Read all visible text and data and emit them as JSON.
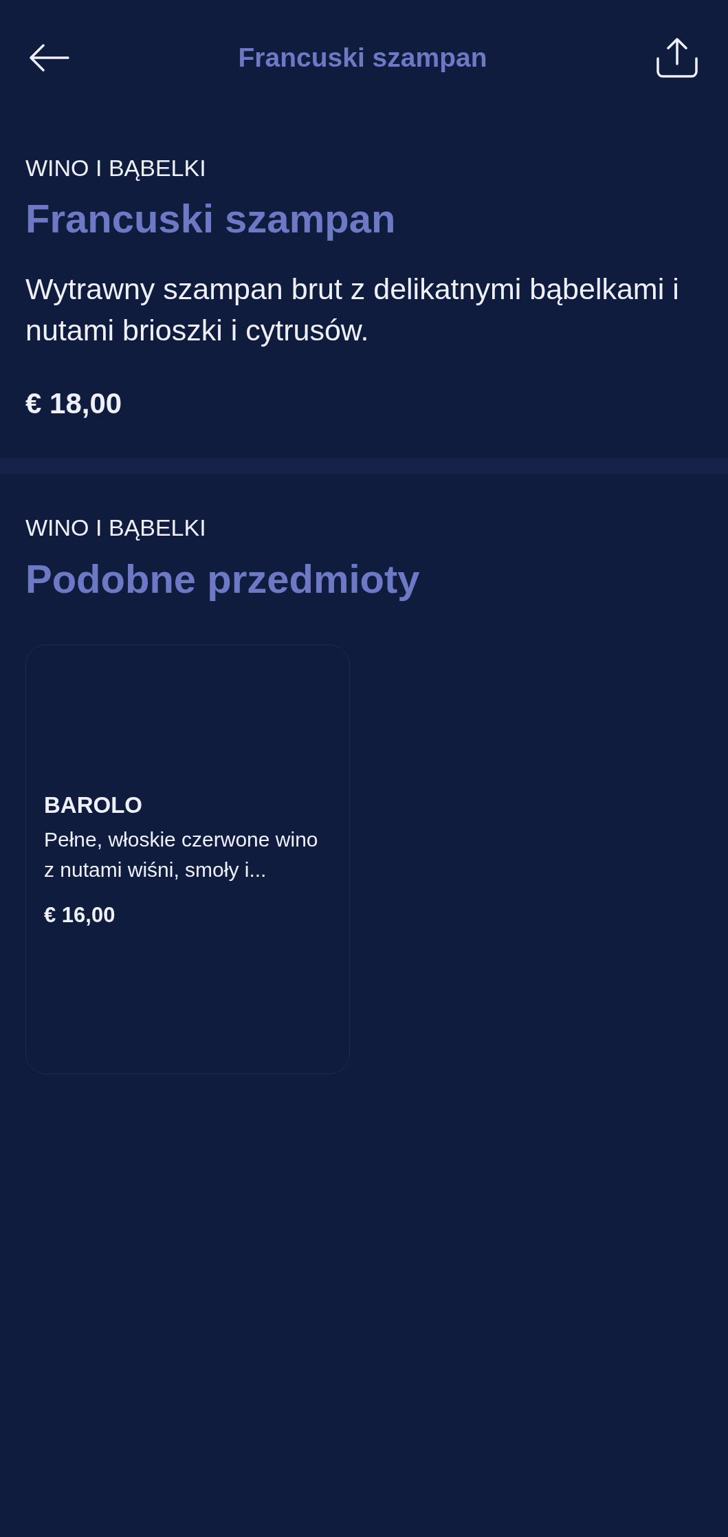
{
  "header": {
    "title": "Francuski szampan"
  },
  "product": {
    "category": "WINO I BĄBELKI",
    "name": "Francuski szampan",
    "description": "Wytrawny szampan brut z delikatnymi bąbelkami i nutami brioszki i cytrusów.",
    "price": "€ 18,00"
  },
  "similar": {
    "category": "WINO I BĄBELKI",
    "title": "Podobne przedmioty",
    "items": [
      {
        "name": "BAROLO",
        "description": "Pełne, włoskie czerwone wino z nutami wiśni, smoły i...",
        "price": "€ 16,00"
      }
    ]
  }
}
